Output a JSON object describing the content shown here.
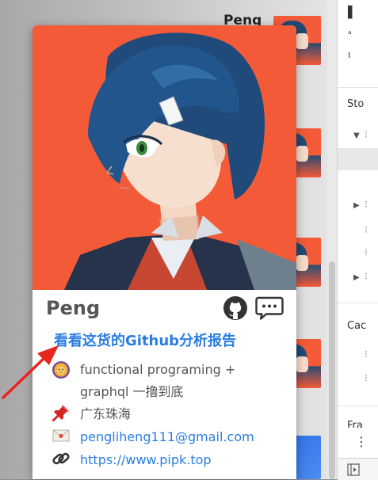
{
  "background": {
    "title_partial": "Peng"
  },
  "card": {
    "name": "Peng",
    "report_link": "看看这货的Github分析报告",
    "bio_lines": [
      "functional programing +",
      "graphql 一撸到底"
    ],
    "location": "广东珠海",
    "email": "pengliheng111@gmail.com",
    "website": "https://www.pipk.top"
  },
  "devtools": {
    "storage_label": "Sto",
    "cache_label": "Cac",
    "frames_label": "Fra"
  },
  "colors": {
    "cover_bg": "#f35a37",
    "link": "#2b7de2",
    "arrow": "#e8241e"
  },
  "icons": [
    "github-icon",
    "comment-icon",
    "lion-icon",
    "pushpin-icon",
    "envelope-icon",
    "link-icon"
  ]
}
